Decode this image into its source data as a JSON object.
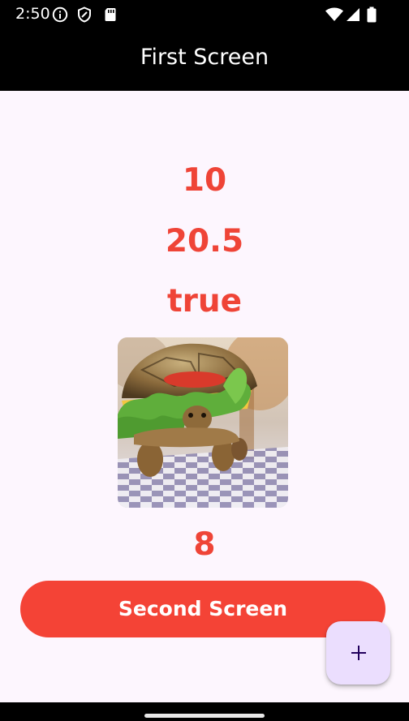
{
  "status_bar": {
    "time": "2:50",
    "icons": [
      "info-icon",
      "shield-icon",
      "sd-card-icon",
      "wifi-icon",
      "signal-icon",
      "battery-icon"
    ]
  },
  "app_bar": {
    "title": "First Screen"
  },
  "main": {
    "int_value": "10",
    "float_value": "20.5",
    "bool_value": "true",
    "image": "turtle burger photo",
    "count_value": "8",
    "primary_button_label": "Second Screen"
  },
  "fab": {
    "icon": "plus-icon"
  },
  "colors": {
    "accent": "#f44336",
    "text_accent": "#ef4437",
    "background": "#fdf6fe",
    "fab_background": "#ebdefe",
    "fab_icon": "#21005d",
    "bar_background": "#000000"
  }
}
